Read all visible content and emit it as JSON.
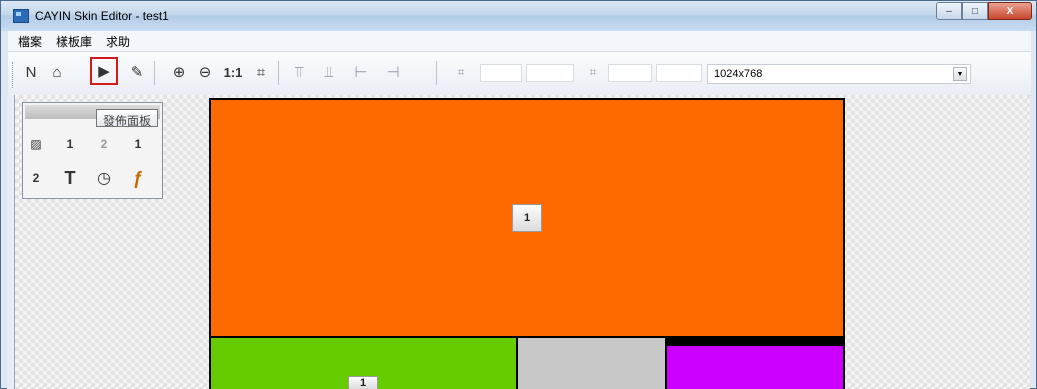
{
  "window": {
    "title": "CAYIN Skin Editor - test1",
    "controls": {
      "minimize": "–",
      "maximize": "□",
      "close": "X"
    }
  },
  "menubar": {
    "items": [
      {
        "label": "檔案"
      },
      {
        "label": "樣板庫"
      },
      {
        "label": "求助"
      }
    ]
  },
  "toolbar": {
    "buttons": [
      {
        "name": "new",
        "glyph": "N"
      },
      {
        "name": "open",
        "glyph": "⌂"
      },
      {
        "name": "publish",
        "glyph": "▶",
        "selected": true
      },
      {
        "name": "edit",
        "glyph": "✎"
      },
      {
        "name": "zoom-in",
        "glyph": "⊕"
      },
      {
        "name": "zoom-out",
        "glyph": "⊖"
      },
      {
        "name": "actual-size",
        "glyph": "1:1"
      },
      {
        "name": "fit",
        "glyph": "⌗"
      },
      {
        "name": "align-top",
        "glyph": "⫪"
      },
      {
        "name": "align-bottom",
        "glyph": "⫫"
      },
      {
        "name": "align-left",
        "glyph": "⊢"
      },
      {
        "name": "align-right",
        "glyph": "⊣"
      }
    ],
    "resolution": "1024x768"
  },
  "palette": {
    "tooltip": "發佈面板",
    "icons": [
      {
        "name": "image",
        "glyph": "▨"
      },
      {
        "name": "video-1",
        "glyph": "1"
      },
      {
        "name": "video-2",
        "glyph": "2"
      },
      {
        "name": "multi-1",
        "glyph": "1"
      },
      {
        "name": "multi-2",
        "glyph": "2"
      },
      {
        "name": "text",
        "glyph": "T"
      },
      {
        "name": "clock",
        "glyph": "◷"
      },
      {
        "name": "flash",
        "glyph": "ƒ"
      }
    ]
  },
  "canvas": {
    "zones": [
      {
        "name": "zone-orange",
        "color": "#ff6a00",
        "badge": "1"
      },
      {
        "name": "zone-green",
        "color": "#66cc00",
        "badge": "1"
      },
      {
        "name": "zone-gray",
        "color": "#c8c8c8"
      },
      {
        "name": "zone-purple",
        "color": "#cc00ff"
      }
    ]
  },
  "colors": {
    "selection": "#d11a1a"
  }
}
